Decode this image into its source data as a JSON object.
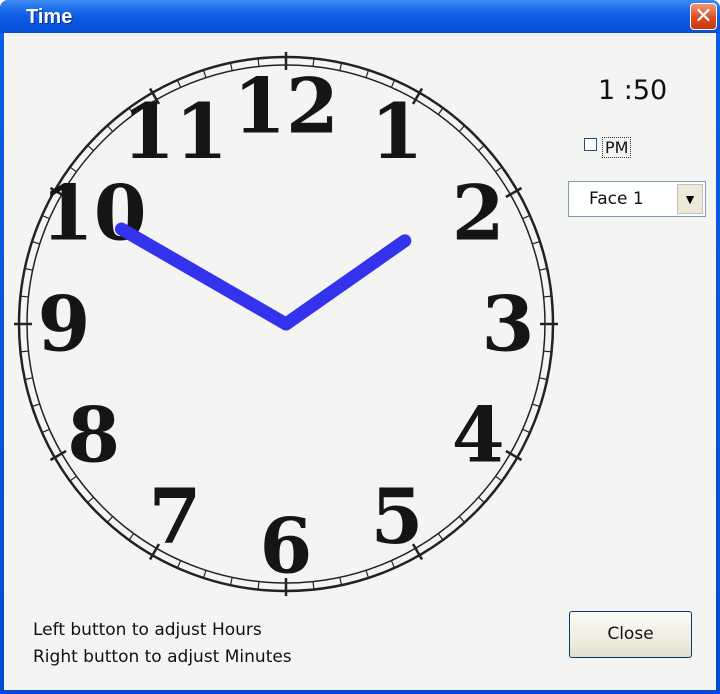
{
  "window": {
    "title": "Time"
  },
  "clock": {
    "numerals": [
      "12",
      "1",
      "2",
      "3",
      "4",
      "5",
      "6",
      "7",
      "8",
      "9",
      "10",
      "11"
    ],
    "hour": 1,
    "minute": 50,
    "hand_color": "#3333ee"
  },
  "time_display": "1 :50",
  "pm": {
    "label": "PM",
    "checked": false
  },
  "face_select": {
    "value": "Face 1"
  },
  "hints": [
    "Left button to adjust Hours",
    "Right button to adjust Minutes"
  ],
  "buttons": {
    "close_label": "Close"
  },
  "icons": {
    "close": "close-x-icon",
    "dropdown": "dropdown-arrow-icon"
  }
}
